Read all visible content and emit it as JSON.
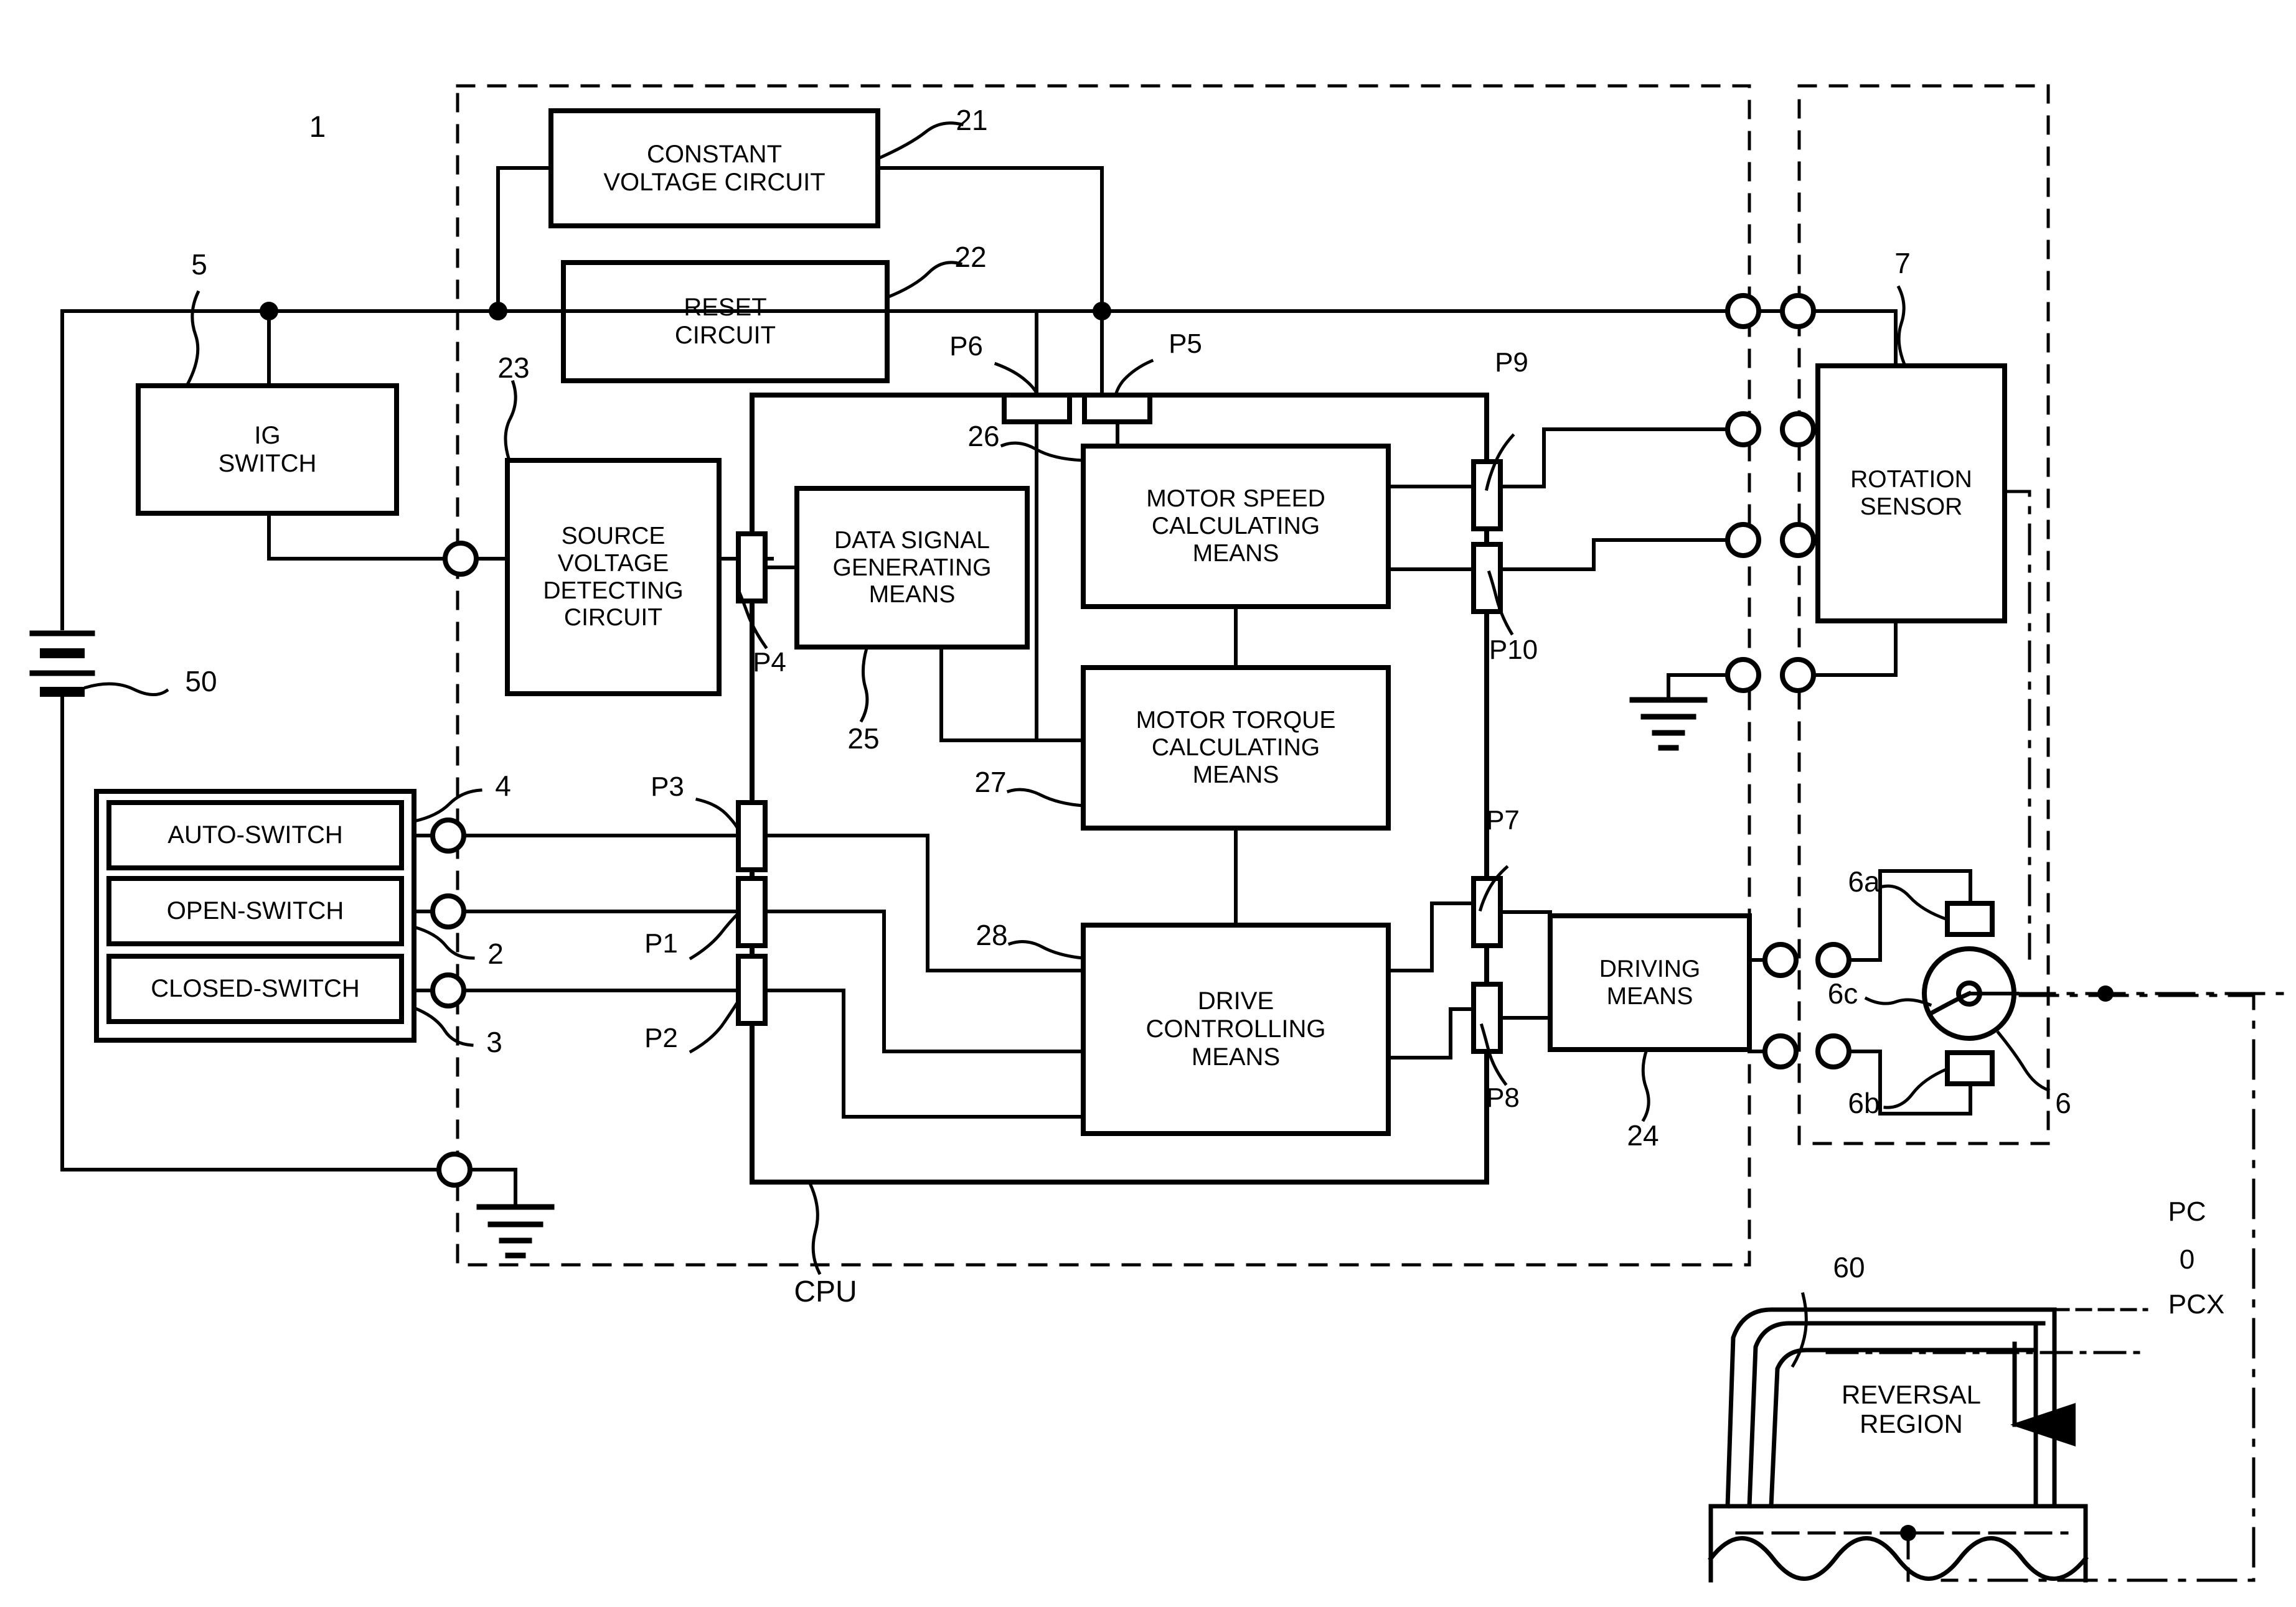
{
  "figure": {
    "system_ref": "1",
    "cpu_label": "CPU"
  },
  "blocks": {
    "constant_voltage_circuit": {
      "label": "CONSTANT\nVOLTAGE CIRCUIT",
      "ref": "21"
    },
    "reset_circuit": {
      "label": "RESET\nCIRCUIT",
      "ref": "22"
    },
    "source_voltage_detecting_circuit": {
      "label": "SOURCE\nVOLTAGE\nDETECTING\nCIRCUIT",
      "ref": "23"
    },
    "ig_switch": {
      "label": "IG\nSWITCH",
      "ref": "5"
    },
    "battery": {
      "ref": "50"
    },
    "data_signal_generating_means": {
      "label": "DATA SIGNAL\nGENERATING\nMEANS",
      "ref": "25"
    },
    "motor_speed_calculating_means": {
      "label": "MOTOR SPEED\nCALCULATING\nMEANS",
      "ref": "26"
    },
    "motor_torque_calculating_means": {
      "label": "MOTOR TORQUE\nCALCULATING\nMEANS",
      "ref": "27"
    },
    "drive_controlling_means": {
      "label": "DRIVE\nCONTROLLING\nMEANS",
      "ref": "28"
    },
    "driving_means": {
      "label": "DRIVING\nMEANS",
      "ref": "24"
    },
    "rotation_sensor": {
      "label": "ROTATION\nSENSOR",
      "ref": "7"
    },
    "motor": {
      "ref": "6",
      "terminal_a": "6a",
      "terminal_b": "6b",
      "body_ref": "6c"
    },
    "window": {
      "label": "REVERSAL\nREGION",
      "ref": "60"
    }
  },
  "switch_panel": {
    "ref": "4",
    "items": [
      {
        "label": "AUTO-SWITCH",
        "ref": "4"
      },
      {
        "label": "OPEN-SWITCH",
        "ref": "2"
      },
      {
        "label": "CLOSED-SWITCH",
        "ref": "3"
      }
    ]
  },
  "ports": {
    "p1": "P1",
    "p2": "P2",
    "p3": "P3",
    "p4": "P4",
    "p5": "P5",
    "p6": "P6",
    "p7": "P7",
    "p8": "P8",
    "p9": "P9",
    "p10": "P10"
  },
  "position_labels": {
    "pc": "PC",
    "zero": "0",
    "pcx": "PCX"
  },
  "colors": {
    "line": "#000000",
    "background": "#ffffff"
  }
}
